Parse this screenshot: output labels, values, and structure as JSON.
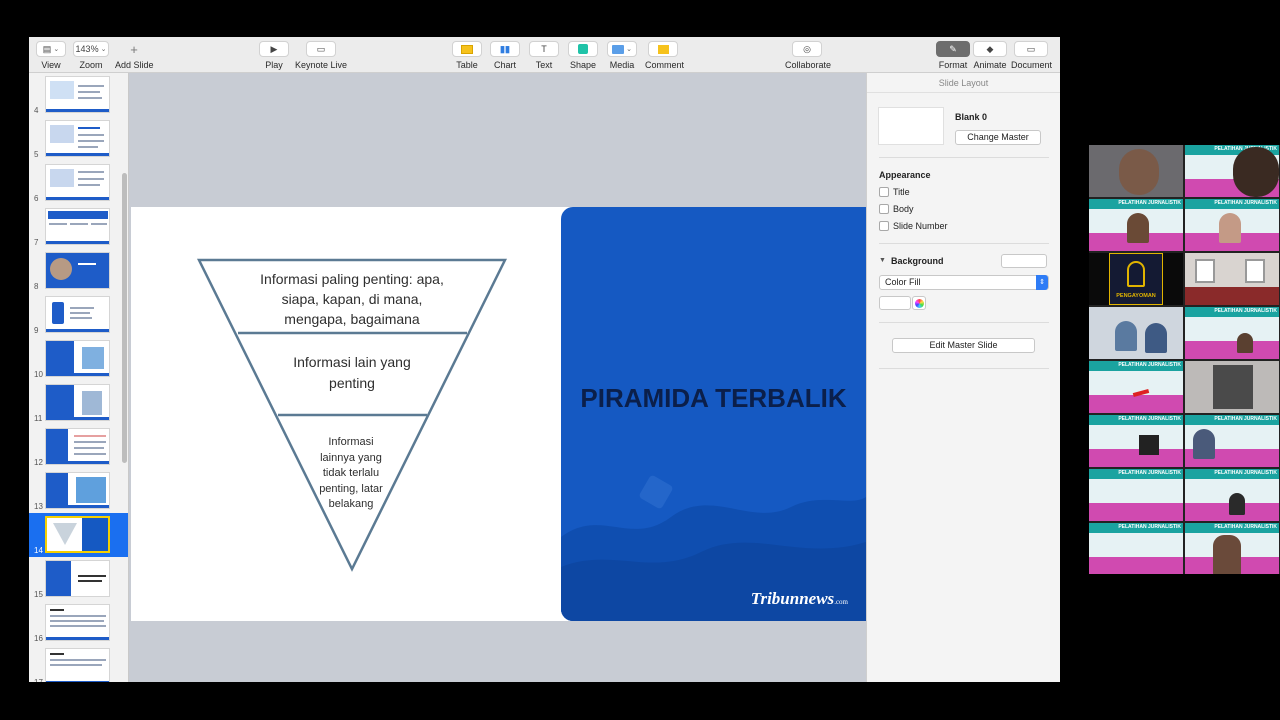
{
  "toolbar": {
    "view_label": "View",
    "zoom_value": "143%",
    "zoom_label": "Zoom",
    "add_slide_label": "Add Slide",
    "play_label": "Play",
    "keynote_live_label": "Keynote Live",
    "table_label": "Table",
    "chart_label": "Chart",
    "text_label": "Text",
    "shape_label": "Shape",
    "media_label": "Media",
    "comment_label": "Comment",
    "collaborate_label": "Collaborate",
    "format_label": "Format",
    "animate_label": "Animate",
    "document_label": "Document"
  },
  "sidebar": {
    "slides": [
      {
        "num": "4"
      },
      {
        "num": "5"
      },
      {
        "num": "6"
      },
      {
        "num": "7"
      },
      {
        "num": "8"
      },
      {
        "num": "9"
      },
      {
        "num": "10"
      },
      {
        "num": "11"
      },
      {
        "num": "12"
      },
      {
        "num": "13"
      },
      {
        "num": "14"
      },
      {
        "num": "15"
      },
      {
        "num": "16"
      },
      {
        "num": "17"
      }
    ],
    "selected": "14"
  },
  "slide": {
    "title": "PIRAMIDA TERBALIK",
    "level1": "Informasi paling penting: apa, siapa, kapan, di mana, mengapa, bagaimana",
    "level2": "Informasi lain yang penting",
    "level3": "Informasi lainnya yang tidak terlalu penting, latar belakang",
    "logo_text": "Tribunnews",
    "logo_suffix": ".com"
  },
  "inspector": {
    "header": "Slide Layout",
    "master_name": "Blank 0",
    "change_master_label": "Change Master",
    "appearance_label": "Appearance",
    "checkbox_title": "Title",
    "checkbox_body": "Body",
    "checkbox_slide_number": "Slide Number",
    "background_label": "Background",
    "fill_type": "Color Fill",
    "edit_master_label": "Edit Master Slide"
  },
  "video_call": {
    "banner_text": "PELATIHAN JURNALISTIK",
    "logo_text": "PENGAYOMAN"
  },
  "colors": {
    "slide_blue": "#1559c2",
    "selection_blue": "#1a6ff0",
    "pyramid_stroke": "#5b7a93"
  }
}
